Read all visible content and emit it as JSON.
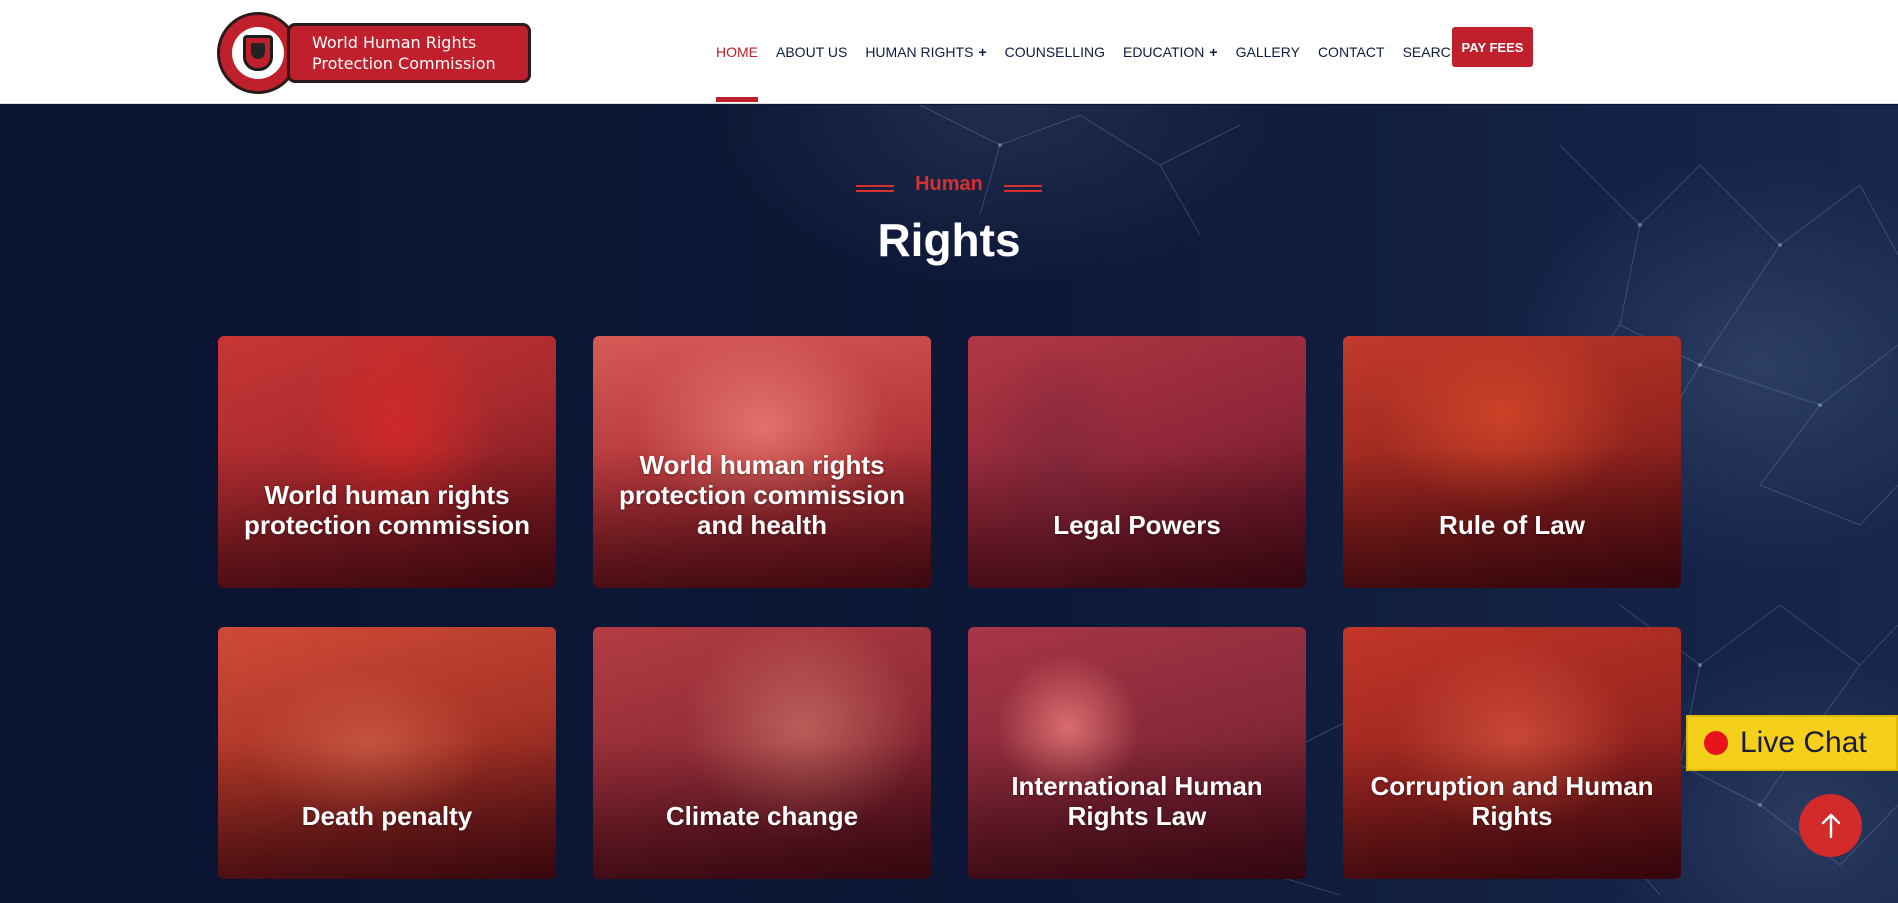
{
  "header": {
    "logo_text": "World Human Rights Protection Commission",
    "nav": [
      {
        "label": "HOME",
        "active": true
      },
      {
        "label": "ABOUT US"
      },
      {
        "label": "HUMAN RIGHTS",
        "has_submenu": true
      },
      {
        "label": "COUNSELLING"
      },
      {
        "label": "EDUCATION",
        "has_submenu": true
      },
      {
        "label": "GALLERY"
      },
      {
        "label": "CONTACT"
      },
      {
        "label": "SEARCH"
      }
    ],
    "pay_fees_label": "PAY FEES",
    "submenu_icon": "+"
  },
  "section": {
    "subtitle": "Human",
    "title": "Rights"
  },
  "cards": [
    {
      "label": "World human rights protection commission"
    },
    {
      "label": "World human rights protection commission and health"
    },
    {
      "label": "Legal Powers"
    },
    {
      "label": "Rule of Law"
    },
    {
      "label": "Death penalty"
    },
    {
      "label": "Climate change"
    },
    {
      "label": "International Human Rights Law"
    },
    {
      "label": "Corruption and Human Rights"
    }
  ],
  "widgets": {
    "live_chat_label": "Live Chat",
    "back_to_top_icon": "arrow-up-icon"
  },
  "colors": {
    "accent": "#c0202b",
    "background": "#0b1533",
    "live_chat": "#f4d01b"
  }
}
